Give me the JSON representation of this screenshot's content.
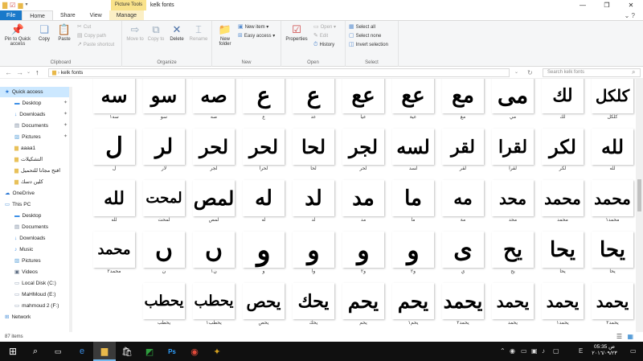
{
  "window": {
    "context_tab": "Picture Tools",
    "title": "kelk fonts"
  },
  "tabs": [
    "File",
    "Home",
    "Share",
    "View",
    "Manage"
  ],
  "ribbon": {
    "clipboard": {
      "pin": "Pin to Quick access",
      "copy": "Copy",
      "paste": "Paste",
      "cut": "Cut",
      "copy_path": "Copy path",
      "paste_shortcut": "Paste shortcut",
      "label": "Clipboard"
    },
    "organize": {
      "move_to": "Move to",
      "copy_to": "Copy to",
      "delete": "Delete",
      "rename": "Rename",
      "label": "Organize"
    },
    "new": {
      "new_folder": "New folder",
      "new_item": "New item",
      "easy_access": "Easy access",
      "label": "New"
    },
    "open": {
      "properties": "Properties",
      "open": "Open",
      "edit": "Edit",
      "history": "History",
      "label": "Open"
    },
    "select": {
      "select_all": "Select all",
      "select_none": "Select none",
      "invert": "Invert selection",
      "label": "Select"
    }
  },
  "address": {
    "path": "kelk fonts",
    "search_placeholder": "Search kelk fonts"
  },
  "nav": {
    "items": [
      {
        "label": "Quick access",
        "icon": "star-icon",
        "color": "#2b78d4",
        "pinned": false,
        "selected": true,
        "indent": 0
      },
      {
        "label": "Desktop",
        "icon": "desktop-icon",
        "color": "#3a8ee6",
        "pinned": true,
        "selected": false,
        "indent": 1
      },
      {
        "label": "Downloads",
        "icon": "download-icon",
        "color": "#3a8ee6",
        "pinned": true,
        "selected": false,
        "indent": 1
      },
      {
        "label": "Documents",
        "icon": "documents-icon",
        "color": "#7a8aa0",
        "pinned": true,
        "selected": false,
        "indent": 1
      },
      {
        "label": "Pictures",
        "icon": "pictures-icon",
        "color": "#5aa0d8",
        "pinned": true,
        "selected": false,
        "indent": 1
      },
      {
        "label": "aaaa1",
        "icon": "folder-icon",
        "color": "#e8c15a",
        "pinned": false,
        "selected": false,
        "indent": 1
      },
      {
        "label": "التشكيلات",
        "icon": "folder-icon",
        "color": "#e8c15a",
        "pinned": false,
        "selected": false,
        "indent": 1
      },
      {
        "label": "افتح مجانا للتحميل",
        "icon": "folder-icon",
        "color": "#e8c15a",
        "pinned": false,
        "selected": false,
        "indent": 1
      },
      {
        "label": "كلين دسك",
        "icon": "folder-icon",
        "color": "#e8c15a",
        "pinned": false,
        "selected": false,
        "indent": 1
      },
      {
        "label": "OneDrive",
        "icon": "cloud-icon",
        "color": "#2b78d4",
        "pinned": false,
        "selected": false,
        "indent": 0
      },
      {
        "label": "This PC",
        "icon": "pc-icon",
        "color": "#4a90d9",
        "pinned": false,
        "selected": false,
        "indent": 0
      },
      {
        "label": "Desktop",
        "icon": "desktop-icon",
        "color": "#3a8ee6",
        "pinned": false,
        "selected": false,
        "indent": 1
      },
      {
        "label": "Documents",
        "icon": "documents-icon",
        "color": "#7a8aa0",
        "pinned": false,
        "selected": false,
        "indent": 1
      },
      {
        "label": "Downloads",
        "icon": "download-icon",
        "color": "#3a8ee6",
        "pinned": false,
        "selected": false,
        "indent": 1
      },
      {
        "label": "Music",
        "icon": "music-icon",
        "color": "#3a8ee6",
        "pinned": false,
        "selected": false,
        "indent": 1
      },
      {
        "label": "Pictures",
        "icon": "pictures-icon",
        "color": "#5aa0d8",
        "pinned": false,
        "selected": false,
        "indent": 1
      },
      {
        "label": "Videos",
        "icon": "videos-icon",
        "color": "#5a6a80",
        "pinned": false,
        "selected": false,
        "indent": 1
      },
      {
        "label": "Local Disk (C:)",
        "icon": "disk-icon",
        "color": "#8a9ab0",
        "pinned": false,
        "selected": false,
        "indent": 1
      },
      {
        "label": "MaHMoud (E:)",
        "icon": "disk-icon",
        "color": "#8a9ab0",
        "pinned": false,
        "selected": false,
        "indent": 1
      },
      {
        "label": "mahmoud 2  (F:)",
        "icon": "disk-icon",
        "color": "#8a9ab0",
        "pinned": false,
        "selected": false,
        "indent": 1
      },
      {
        "label": "Network",
        "icon": "network-icon",
        "color": "#4a90d9",
        "pinned": false,
        "selected": false,
        "indent": 0
      }
    ]
  },
  "files": [
    [
      {
        "glyph": "كلكل",
        "caption": "كلكل",
        "size": 20
      },
      {
        "glyph": "لك",
        "caption": "لك",
        "size": 22
      },
      {
        "glyph": "مى",
        "caption": "مي",
        "size": 28
      },
      {
        "glyph": "مع",
        "caption": "مع",
        "size": 26
      },
      {
        "glyph": "عع",
        "caption": "عية",
        "size": 26
      },
      {
        "glyph": "عع",
        "caption": "عيا",
        "size": 26
      },
      {
        "glyph": "ع",
        "caption": "عد",
        "size": 28
      },
      {
        "glyph": "ع",
        "caption": "ع",
        "size": 28
      },
      {
        "glyph": "صه",
        "caption": "صه",
        "size": 24
      },
      {
        "glyph": "سو",
        "caption": "سو",
        "size": 24
      },
      {
        "glyph": "سه",
        "caption": "سه١",
        "size": 24
      }
    ],
    [
      {
        "glyph": "لله",
        "caption": "لله",
        "size": 24
      },
      {
        "glyph": "لكر",
        "caption": "لكر",
        "size": 24
      },
      {
        "glyph": "لقرا",
        "caption": "لقرا",
        "size": 22
      },
      {
        "glyph": "لقر",
        "caption": "لقر",
        "size": 22
      },
      {
        "glyph": "لسه",
        "caption": "لسد",
        "size": 24
      },
      {
        "glyph": "لجر",
        "caption": "لحر",
        "size": 24
      },
      {
        "glyph": "لحا",
        "caption": "لحا",
        "size": 24
      },
      {
        "glyph": "لحر",
        "caption": "لحرا",
        "size": 24
      },
      {
        "glyph": "لحر",
        "caption": "لجر",
        "size": 24
      },
      {
        "glyph": "لر",
        "caption": "لار",
        "size": 26
      },
      {
        "glyph": "ل",
        "caption": "ل",
        "size": 30
      }
    ],
    [
      {
        "glyph": "محمد",
        "caption": "محمد١",
        "size": 20
      },
      {
        "glyph": "محمد",
        "caption": "محمد",
        "size": 20
      },
      {
        "glyph": "محد",
        "caption": "محد",
        "size": 20
      },
      {
        "glyph": "مه",
        "caption": "مة",
        "size": 22
      },
      {
        "glyph": "ما",
        "caption": "ما",
        "size": 26
      },
      {
        "glyph": "مد",
        "caption": "مد",
        "size": 26
      },
      {
        "glyph": "لد",
        "caption": "لد",
        "size": 26
      },
      {
        "glyph": "له",
        "caption": "له",
        "size": 26
      },
      {
        "glyph": "لمص",
        "caption": "لمص",
        "size": 24
      },
      {
        "glyph": "لمحت",
        "caption": "لمحت",
        "size": 18
      },
      {
        "glyph": "لله",
        "caption": "لله",
        "size": 22
      }
    ],
    [
      {
        "glyph": "يحا",
        "caption": "يحا",
        "size": 26
      },
      {
        "glyph": "يحا",
        "caption": "يحا",
        "size": 26
      },
      {
        "glyph": "يح",
        "caption": "يح",
        "size": 26
      },
      {
        "glyph": "ى",
        "caption": "ي",
        "size": 30
      },
      {
        "glyph": "و",
        "caption": "و٢",
        "size": 32
      },
      {
        "glyph": "و",
        "caption": "و٢",
        "size": 32
      },
      {
        "glyph": "و",
        "caption": "وا",
        "size": 32
      },
      {
        "glyph": "و",
        "caption": "و",
        "size": 36
      },
      {
        "glyph": "ں",
        "caption": "ن١",
        "size": 30
      },
      {
        "glyph": "ں",
        "caption": "ن",
        "size": 30
      },
      {
        "glyph": "محمد",
        "caption": "محمد٢",
        "size": 18
      }
    ],
    [
      {
        "glyph": "يحمد",
        "caption": "يحمد٢",
        "size": 20
      },
      {
        "glyph": "يحمد",
        "caption": "يحمد١",
        "size": 20
      },
      {
        "glyph": "يحمد",
        "caption": "يحمد",
        "size": 20
      },
      {
        "glyph": "يحمد",
        "caption": "يحمد٢",
        "size": 24
      },
      {
        "glyph": "يحم",
        "caption": "يحم١",
        "size": 24
      },
      {
        "glyph": "يحم",
        "caption": "يحم",
        "size": 24
      },
      {
        "glyph": "يحك",
        "caption": "يحك",
        "size": 22
      },
      {
        "glyph": "يحص",
        "caption": "يحص",
        "size": 20
      },
      {
        "glyph": "يحطب",
        "caption": "يحطب١",
        "size": 18
      },
      {
        "glyph": "يحطب",
        "caption": "يحطب",
        "size": 18
      }
    ]
  ],
  "status": {
    "count": "87 items"
  },
  "taskbar": {
    "lang": "E",
    "time": "05:35 ص",
    "date": "٢٠١٦/٠٩/٢٣"
  }
}
